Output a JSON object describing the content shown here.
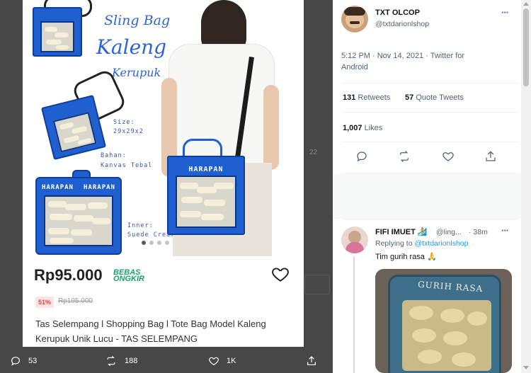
{
  "viewer": {
    "product": {
      "headline_line1": "Sling Bag",
      "headline_line2": "Kaleng",
      "headline_line3": "Kerupuk",
      "size_label": "Size:",
      "size_value": "29x29x2",
      "material_label": "Bahan:",
      "material_value": "Kanvas Tebal",
      "inner_label": "Inner:",
      "inner_value": "Suede Cream",
      "bag_brand": "HARAPAN",
      "tin_brand_left": "HARAPAN",
      "tin_brand_right": "HARAPAN",
      "price": "Rp95.000",
      "free_shipping_line1": "BEBAS",
      "free_shipping_line2": "ONGKIR",
      "discount_badge": "51%",
      "original_price": "Rp195.000",
      "name": "Tas Selempang l Shopping Bag l Tote Bag Model Kaleng Kerupuk Unik Lucu - TAS SELEMPANG",
      "carousel_dots": 4,
      "carousel_active_index": 1
    },
    "bottom_bar": {
      "reply_count": "53",
      "retweet_count": "188",
      "like_count": "1K"
    }
  },
  "tweet": {
    "author_name": "TXT OLCOP",
    "author_handle": "@txtdarionlshop",
    "timestamp": "5:12 PM · Nov 14, 2021 · Twitter for Android",
    "retweets_value": "131",
    "retweets_label": "Retweets",
    "quote_value": "57",
    "quote_label": "Quote Tweets",
    "likes_value": "1,007",
    "likes_label": "Likes"
  },
  "reply": {
    "author_name": "FIFI IMUET",
    "author_emoji": "🏄",
    "author_handle": "@ling...",
    "time": "· 38m",
    "replying_prefix": "Replying to",
    "replying_handle": "@txtdarionlshop",
    "text": "Tim gurih rasa 🙏",
    "image_label": "GURIH RASA"
  },
  "colors": {
    "link": "#1d9bf0",
    "bag_blue": "#1f5fd0",
    "price_green": "#16a36a",
    "discount_red": "#e0453b"
  },
  "icons": [
    "reply-icon",
    "retweet-icon",
    "heart-icon",
    "share-icon",
    "more-icon",
    "favorite-heart-icon"
  ]
}
